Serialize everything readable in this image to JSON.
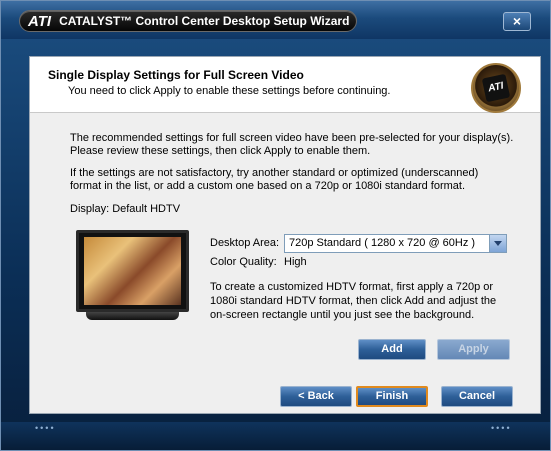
{
  "window": {
    "logo": "ATI",
    "title": "CATALYST™ Control Center Desktop Setup Wizard",
    "close_label": "×"
  },
  "header": {
    "title": "Single Display Settings for Full Screen Video",
    "subtitle": "You need to click Apply to enable these settings before continuing.",
    "badge_logo": "ATI"
  },
  "body": {
    "intro_line1": "The recommended settings for full screen video have been pre-selected for your display(s).",
    "intro_line2": "Please review these settings, then click Apply to enable them.",
    "alt_line1": "If the settings are not satisfactory, try another standard or optimized (underscanned)",
    "alt_line2": "format in the list, or add a custom one based on a 720p or 1080i standard format.",
    "display_label": "Display:",
    "display_value": "Default HDTV"
  },
  "settings": {
    "desktop_area_label": "Desktop Area:",
    "desktop_area_value": "720p Standard ( 1280 x 720 @ 60Hz )",
    "color_quality_label": "Color Quality:",
    "color_quality_value": "High",
    "custom_line1": "To create a customized HDTV format, first apply a 720p or",
    "custom_line2": "1080i standard HDTV format, then click Add and adjust the",
    "custom_line3": "on-screen rectangle until you just see the background."
  },
  "buttons": {
    "add": "Add",
    "apply": "Apply",
    "back": "< Back",
    "finish": "Finish",
    "cancel": "Cancel"
  },
  "footer": {
    "dots_left": "••••",
    "dots_right": "••••"
  }
}
